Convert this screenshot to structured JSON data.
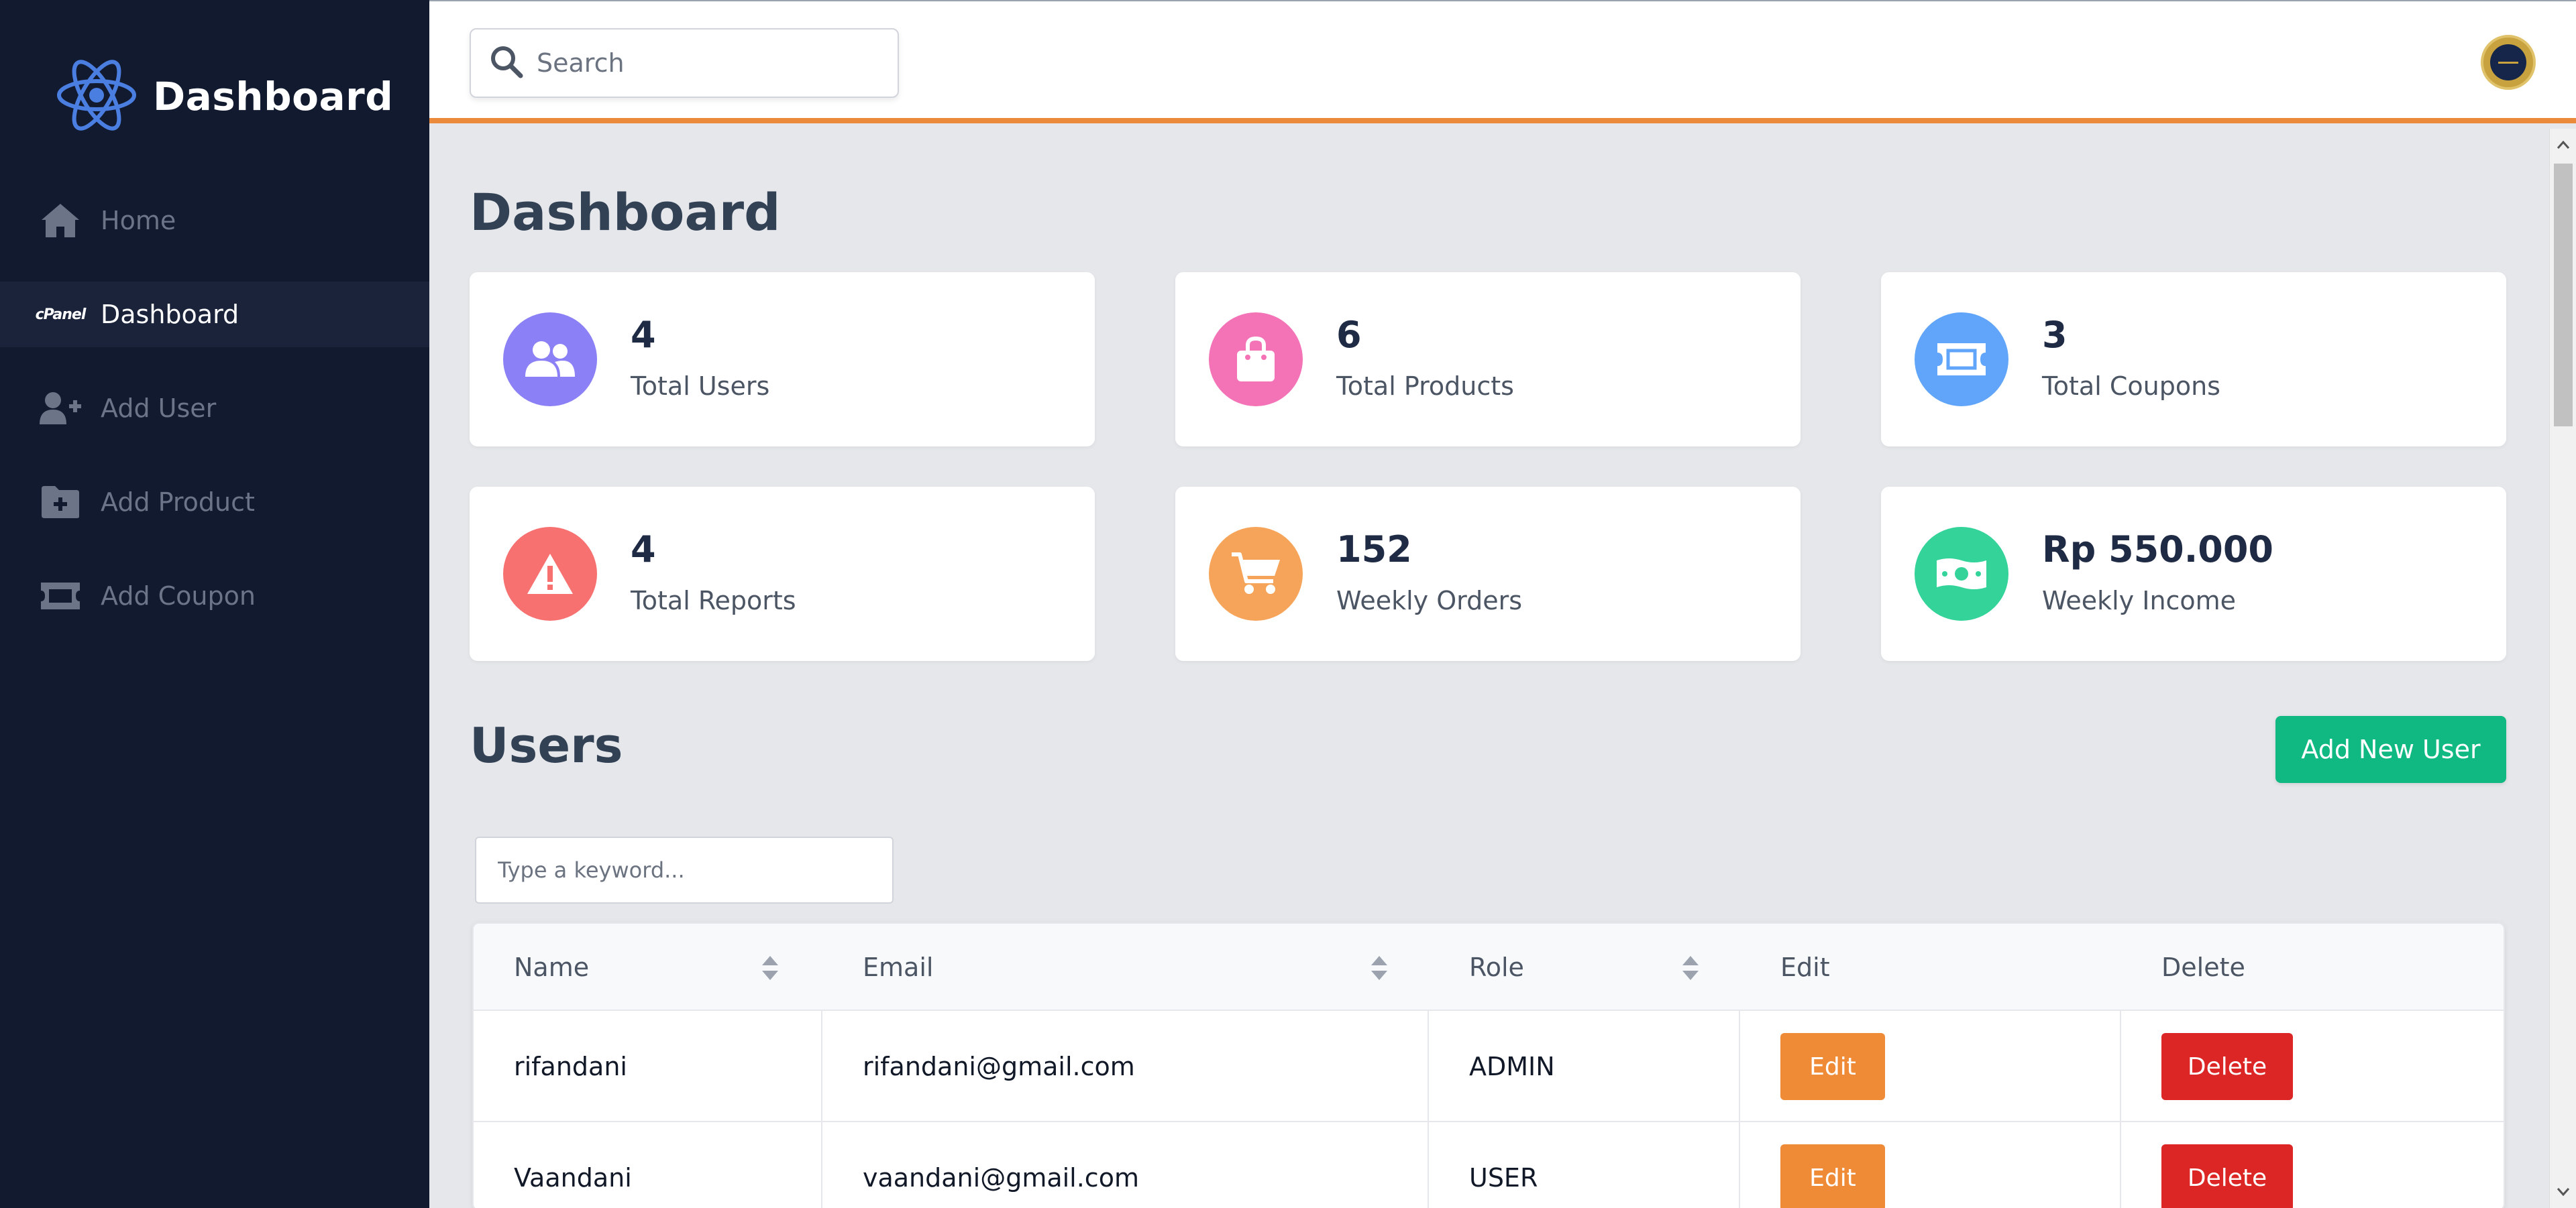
{
  "sidebar": {
    "brand": "Dashboard",
    "items": [
      {
        "label": "Home",
        "icon": "home-icon",
        "active": false
      },
      {
        "label": "Dashboard",
        "icon": "cpanel-icon",
        "icon_text": "cPanel",
        "active": true
      },
      {
        "label": "Add User",
        "icon": "user-plus-icon",
        "active": false
      },
      {
        "label": "Add Product",
        "icon": "folder-plus-icon",
        "active": false
      },
      {
        "label": "Add Coupon",
        "icon": "ticket-icon",
        "active": false
      }
    ]
  },
  "topbar": {
    "search_placeholder": "Search"
  },
  "page": {
    "title": "Dashboard"
  },
  "stats": [
    {
      "value": "4",
      "label": "Total Users",
      "icon": "users-icon",
      "color": "#8b80f5"
    },
    {
      "value": "6",
      "label": "Total Products",
      "icon": "shopping-bag-icon",
      "color": "#f472b6"
    },
    {
      "value": "3",
      "label": "Total Coupons",
      "icon": "ticket-icon",
      "color": "#60a5fa"
    },
    {
      "value": "4",
      "label": "Total Reports",
      "icon": "warning-icon",
      "color": "#f87171"
    },
    {
      "value": "152",
      "label": "Weekly Orders",
      "icon": "cart-icon",
      "color": "#f6a45a"
    },
    {
      "value": "Rp 550.000",
      "label": "Weekly Income",
      "icon": "money-icon",
      "color": "#34d399"
    }
  ],
  "users": {
    "title": "Users",
    "add_button": "Add New User",
    "keyword_placeholder": "Type a keyword...",
    "columns": [
      "Name",
      "Email",
      "Role",
      "Edit",
      "Delete"
    ],
    "rows": [
      {
        "name": "rifandani",
        "email": "rifandani@gmail.com",
        "role": "ADMIN",
        "edit": "Edit",
        "delete": "Delete"
      },
      {
        "name": "Vaandani",
        "email": "vaandani@gmail.com",
        "role": "USER",
        "edit": "Edit",
        "delete": "Delete"
      }
    ]
  },
  "colors": {
    "sidebar_bg": "#121a30",
    "accent_orange": "#ec8a3c",
    "add_button": "#10b981",
    "edit_button": "#ef8a37",
    "delete_button": "#dc2626"
  }
}
